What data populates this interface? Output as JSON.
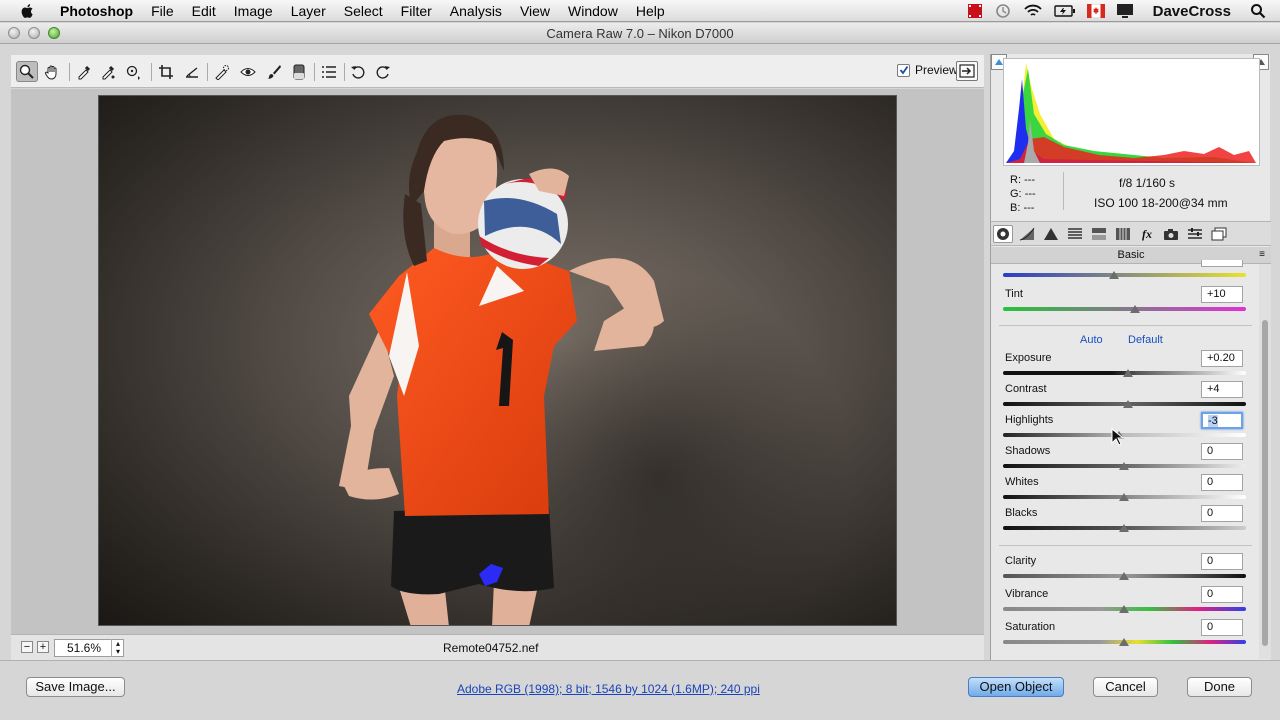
{
  "menubar": {
    "app_name": "Photoshop",
    "items": [
      "File",
      "Edit",
      "Image",
      "Layer",
      "Select",
      "Filter",
      "Analysis",
      "View",
      "Window",
      "Help"
    ],
    "user": "DaveCross",
    "status_icons": [
      "film-icon",
      "time-machine-icon",
      "wifi-icon",
      "battery-icon",
      "canada-flag-icon",
      "display-icon",
      "spotlight-icon"
    ]
  },
  "window": {
    "title": "Camera Raw 7.0  –  Nikon D7000"
  },
  "toolbar": {
    "tools": [
      "zoom",
      "hand",
      "white-balance",
      "color-sampler",
      "target-adjustment",
      "crop",
      "straighten",
      "spot-removal",
      "red-eye",
      "adjustment-brush",
      "graduated-filter",
      "preferences",
      "rotate-left",
      "rotate-right"
    ],
    "preview_label": "Preview",
    "preview_checked": true
  },
  "canvas": {
    "zoom_value": "51.6%",
    "filename": "Remote04752.nef"
  },
  "histogram": {
    "r_label": "R:",
    "r_value": "---",
    "g_label": "G:",
    "g_value": "---",
    "b_label": "B:",
    "b_value": "---",
    "camera_info_1": "f/8   1/160 s",
    "camera_info_2": "ISO 100   18-200@34 mm"
  },
  "panel": {
    "tabs": [
      "basic",
      "tone-curve",
      "detail",
      "hsl",
      "split-toning",
      "lens-corrections",
      "effects",
      "camera-calibration",
      "presets",
      "snapshots"
    ],
    "header": "Basic",
    "auto_label": "Auto",
    "default_label": "Default",
    "controls": [
      {
        "label": "Tint",
        "value": "+10"
      },
      {
        "label": "Exposure",
        "value": "+0.20"
      },
      {
        "label": "Contrast",
        "value": "+4"
      },
      {
        "label": "Highlights",
        "value": "-3"
      },
      {
        "label": "Shadows",
        "value": "0"
      },
      {
        "label": "Whites",
        "value": "0"
      },
      {
        "label": "Blacks",
        "value": "0"
      },
      {
        "label": "Clarity",
        "value": "0"
      },
      {
        "label": "Vibrance",
        "value": "0"
      },
      {
        "label": "Saturation",
        "value": "0"
      }
    ]
  },
  "footer": {
    "save_label": "Save Image...",
    "workflow_link": "Adobe RGB (1998); 8 bit; 1546 by 1024 (1.6MP); 240 ppi",
    "open_label": "Open Object",
    "cancel_label": "Cancel",
    "done_label": "Done"
  }
}
